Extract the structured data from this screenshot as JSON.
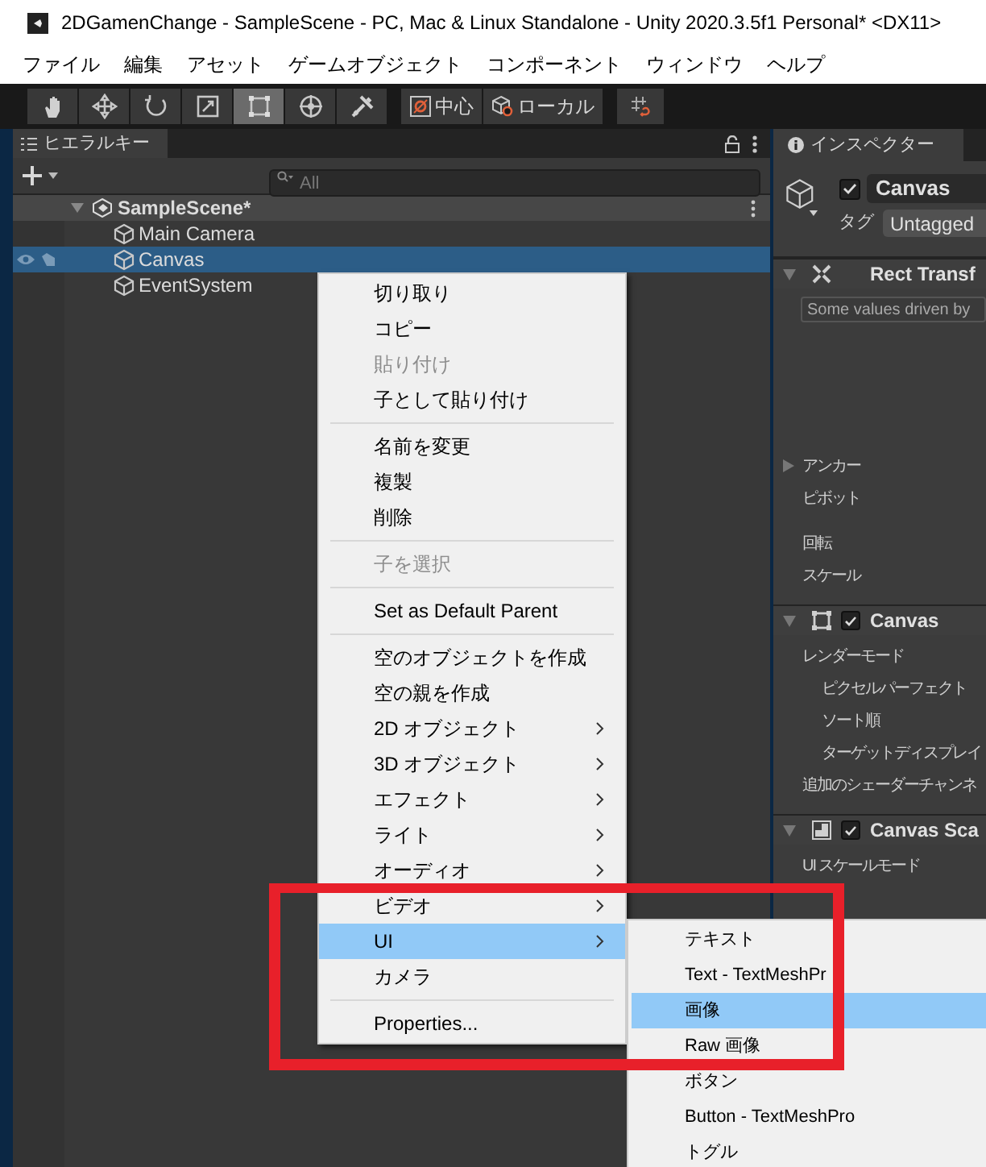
{
  "window": {
    "title": "2DGamenChange - SampleScene - PC, Mac & Linux Standalone - Unity 2020.3.5f1 Personal* <DX11>"
  },
  "menu_bar": [
    "ファイル",
    "編集",
    "アセット",
    "ゲームオブジェクト",
    "コンポーネント",
    "ウィンドウ",
    "ヘルプ"
  ],
  "toolbar": {
    "tools": [
      {
        "kind": "hand",
        "selected": false
      },
      {
        "kind": "move",
        "selected": false
      },
      {
        "kind": "rotate",
        "selected": false
      },
      {
        "kind": "scale",
        "selected": false
      },
      {
        "kind": "rect",
        "selected": true
      },
      {
        "kind": "transform",
        "selected": false
      },
      {
        "kind": "custom",
        "selected": false
      }
    ],
    "pivot_buttons": [
      {
        "kind": "pivot",
        "label": "中心"
      },
      {
        "kind": "space",
        "label": "ローカル"
      }
    ]
  },
  "hierarchy": {
    "tab": "ヒエラルキー",
    "search": {
      "placeholder": "All"
    },
    "scene": {
      "label": "SampleScene*",
      "expanded": true,
      "children": [
        {
          "label": "Main Camera",
          "selected": false
        },
        {
          "label": "Canvas",
          "selected": true
        },
        {
          "label": "EventSystem",
          "selected": false
        }
      ]
    }
  },
  "inspector": {
    "tab": "インスペクター",
    "object": {
      "name": "Canvas",
      "active": true,
      "tag_label": "タグ",
      "tag": "Untagged"
    },
    "components": [
      {
        "kind": "rect_transform",
        "title": "Rect Transf",
        "expanded": true,
        "note": "Some values driven by",
        "fields": [
          {
            "label": "アンカー",
            "expandable": true
          },
          {
            "label": "ピボット",
            "expandable": false
          },
          {
            "label": "回転",
            "expandable": false
          },
          {
            "label": "スケール",
            "expandable": false
          }
        ]
      },
      {
        "kind": "canvas",
        "title": "Canvas",
        "expanded": true,
        "enabled": true,
        "fields": [
          {
            "label": "レンダーモード",
            "expandable": false,
            "children": [
              {
                "label": "ピクセルパーフェクト"
              },
              {
                "label": "ソート順"
              },
              {
                "label": "ターゲットディスプレイ"
              }
            ]
          },
          {
            "label": "追加のシェーダーチャンネ",
            "expandable": false
          }
        ]
      },
      {
        "kind": "canvas_scaler",
        "title": "Canvas Sca",
        "expanded": true,
        "enabled": true,
        "fields": [
          {
            "label": "UI スケールモード",
            "expandable": false
          }
        ]
      }
    ]
  },
  "context_menu": {
    "items": [
      {
        "kind": "item",
        "label": "切り取り",
        "disabled": false,
        "submenu": false,
        "selected": false
      },
      {
        "kind": "item",
        "label": "コピー",
        "disabled": false,
        "submenu": false,
        "selected": false
      },
      {
        "kind": "item",
        "label": "貼り付け",
        "disabled": true,
        "submenu": false,
        "selected": false
      },
      {
        "kind": "item",
        "label": "子として貼り付け",
        "disabled": false,
        "submenu": false,
        "selected": false
      },
      {
        "kind": "separator"
      },
      {
        "kind": "item",
        "label": "名前を変更",
        "disabled": false,
        "submenu": false,
        "selected": false
      },
      {
        "kind": "item",
        "label": "複製",
        "disabled": false,
        "submenu": false,
        "selected": false
      },
      {
        "kind": "item",
        "label": "削除",
        "disabled": false,
        "submenu": false,
        "selected": false
      },
      {
        "kind": "separator"
      },
      {
        "kind": "item",
        "label": "子を選択",
        "disabled": true,
        "submenu": false,
        "selected": false
      },
      {
        "kind": "separator"
      },
      {
        "kind": "item",
        "label": "Set as Default Parent",
        "disabled": false,
        "submenu": false,
        "selected": false
      },
      {
        "kind": "separator"
      },
      {
        "kind": "item",
        "label": "空のオブジェクトを作成",
        "disabled": false,
        "submenu": false,
        "selected": false
      },
      {
        "kind": "item",
        "label": "空の親を作成",
        "disabled": false,
        "submenu": false,
        "selected": false
      },
      {
        "kind": "item",
        "label": "2D オブジェクト",
        "disabled": false,
        "submenu": true,
        "selected": false
      },
      {
        "kind": "item",
        "label": "3D オブジェクト",
        "disabled": false,
        "submenu": true,
        "selected": false
      },
      {
        "kind": "item",
        "label": "エフェクト",
        "disabled": false,
        "submenu": true,
        "selected": false
      },
      {
        "kind": "item",
        "label": "ライト",
        "disabled": false,
        "submenu": true,
        "selected": false
      },
      {
        "kind": "item",
        "label": "オーディオ",
        "disabled": false,
        "submenu": true,
        "selected": false
      },
      {
        "kind": "item",
        "label": "ビデオ",
        "disabled": false,
        "submenu": true,
        "selected": false
      },
      {
        "kind": "item",
        "label": "UI",
        "disabled": false,
        "submenu": true,
        "selected": true
      },
      {
        "kind": "item",
        "label": "カメラ",
        "disabled": false,
        "submenu": false,
        "selected": false
      },
      {
        "kind": "separator"
      },
      {
        "kind": "item",
        "label": "Properties...",
        "disabled": false,
        "submenu": false,
        "selected": false
      }
    ]
  },
  "submenu": {
    "items": [
      {
        "label": "テキスト",
        "selected": false
      },
      {
        "label": "Text - TextMeshPr",
        "selected": false
      },
      {
        "label": "画像",
        "selected": true
      },
      {
        "label": "Raw 画像",
        "selected": false
      },
      {
        "label": "ボタン",
        "selected": false
      },
      {
        "label": "Button - TextMeshPro",
        "selected": false
      },
      {
        "label": "トグル",
        "selected": false
      }
    ]
  }
}
